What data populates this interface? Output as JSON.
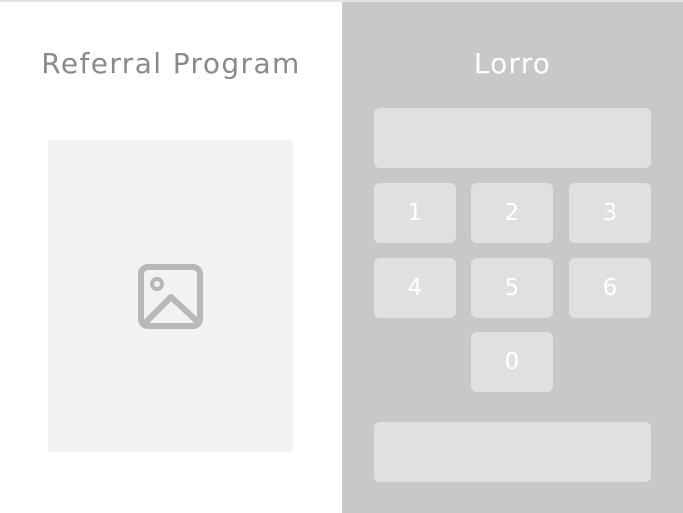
{
  "left": {
    "title": "Referral Program",
    "image": {
      "icon": "image-icon"
    }
  },
  "right": {
    "brand": "Lorro",
    "display": {
      "value": ""
    },
    "keypad": {
      "keys": [
        "1",
        "2",
        "3",
        "4",
        "5",
        "6",
        "0"
      ]
    },
    "submit": {
      "label": ""
    }
  },
  "colors": {
    "left_background": "#ffffff",
    "right_background": "#c8c8c8",
    "key_background": "#e0e0e0",
    "title_text": "#8a8a8a",
    "image_placeholder": "#f2f2f2",
    "icon": "#b8b8b8"
  }
}
